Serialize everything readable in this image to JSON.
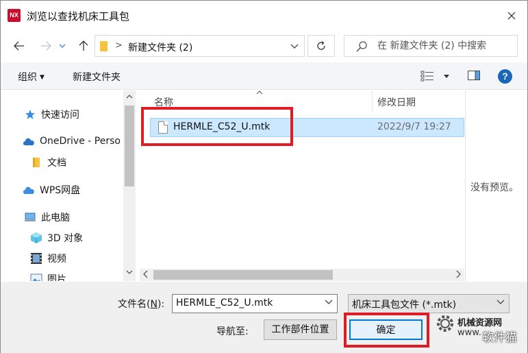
{
  "window": {
    "app_icon_text": "NX",
    "title": "浏览以查找机床工具包"
  },
  "nav": {
    "current_folder": "新建文件夹 (2)",
    "search_placeholder": "在 新建文件夹 (2) 中搜索"
  },
  "toolbar": {
    "organize_label": "组织",
    "new_folder_label": "新建文件夹",
    "help_label": "?"
  },
  "sidebar": {
    "items": [
      {
        "label": "快速访问",
        "icon": "star-icon"
      },
      {
        "label": "OneDrive - Perso",
        "icon": "cloud-icon"
      },
      {
        "label": "文档",
        "icon": "folder-icon"
      },
      {
        "label": "WPS网盘",
        "icon": "cloud-icon"
      },
      {
        "label": "此电脑",
        "icon": "computer-icon"
      },
      {
        "label": "3D 对象",
        "icon": "cube-icon"
      },
      {
        "label": "视频",
        "icon": "film-icon"
      },
      {
        "label": "图片",
        "icon": "picture-icon"
      }
    ]
  },
  "file_list": {
    "columns": {
      "name": "名称",
      "date": "修改日期"
    },
    "rows": [
      {
        "name": "HERMLE_C52_U.mtk",
        "date": "2022/9/7 19:27"
      }
    ]
  },
  "preview": {
    "text": "没有预览。"
  },
  "bottom": {
    "filename_label": "文件名(",
    "filename_label_key": "N",
    "filename_label_end": "):",
    "filename_value": "HERMLE_C52_U.mtk",
    "filetype_value": "机床工具包文件 (*.mtk)",
    "nav_label": "导航至:",
    "workpos_button": "工作部件位置",
    "ok_button": "确定"
  },
  "watermark": {
    "line1": "机械资源网",
    "line2": "www.",
    "line3": "软件猫"
  },
  "colors": {
    "highlight_red": "#e01b24",
    "selection_blue": "#cce8ff",
    "accent_blue": "#0078d7",
    "help_blue": "#1a67b8",
    "app_red": "#c8102e"
  }
}
